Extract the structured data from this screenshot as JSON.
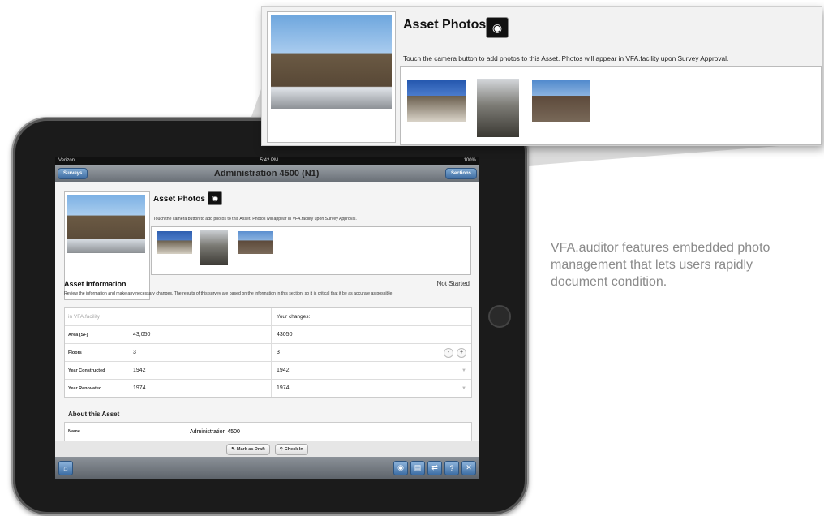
{
  "status_bar": {
    "carrier": "Verizon",
    "time": "5:42 PM",
    "battery": "100%"
  },
  "nav": {
    "back_label": "Surveys",
    "title": "Administration 4500 (N1)",
    "right_label": "Sections"
  },
  "asset_photos": {
    "title": "Asset Photos",
    "camera_icon": "camera-icon",
    "hint": "Touch the camera button to add photos to this Asset. Photos will appear in VFA.facility upon Survey Approval."
  },
  "asset_info": {
    "title": "Asset Information",
    "status": "Not Started",
    "description": "Review the information and make any necessary changes. The results of this survey are based on the information in this section, so it is critical that it be as accurate as possible.",
    "col_left": "in VFA.facility",
    "col_right": "Your changes:",
    "rows": [
      {
        "label": "Area (SF)",
        "facility": "43,050",
        "change": "43050"
      },
      {
        "label": "Floors",
        "facility": "3",
        "change": "3"
      },
      {
        "label": "Year Constructed",
        "facility": "1942",
        "change": "1942"
      },
      {
        "label": "Year Renovated",
        "facility": "1974",
        "change": "1974"
      }
    ]
  },
  "about": {
    "title": "About this Asset",
    "name_label": "Name",
    "name_value": "Administration 4500"
  },
  "actions": {
    "draft_label": "Mark as Draft",
    "checkin_label": "Check In"
  },
  "caption": "VFA.auditor features embedded photo management that lets users rapidly document condition.",
  "colors": {
    "nav_button": "#4a78ab",
    "caption_text": "#8a8a8a"
  }
}
